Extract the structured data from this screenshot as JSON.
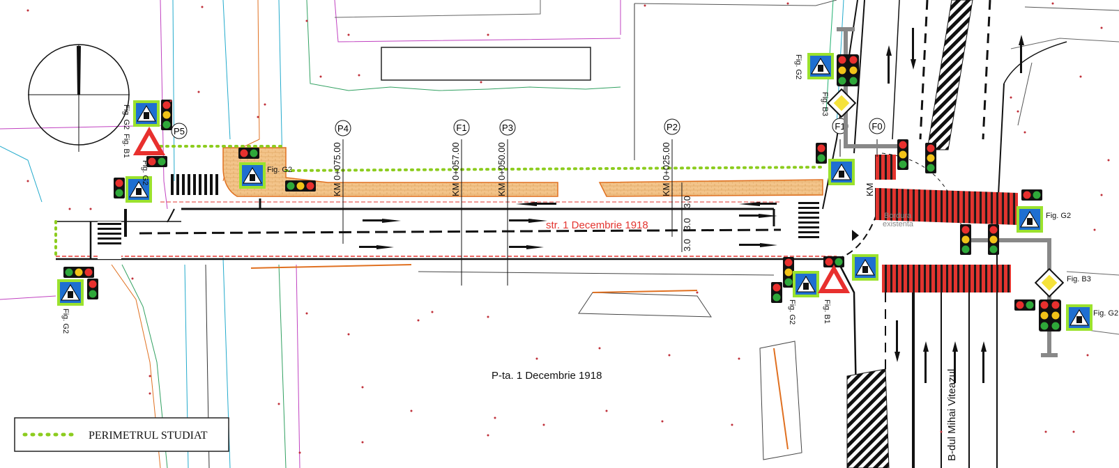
{
  "streets": {
    "main": "str. 1 Decembrie 1918",
    "square": "P-ta. 1 Decembrie 1918",
    "boulevard": "B-dul Mihai Viteazul"
  },
  "existing_note": [
    "Bordura",
    "existenta"
  ],
  "legend": {
    "label": "PERIMETRUL STUDIAT"
  },
  "profiles": [
    "P5",
    "P4",
    "F1",
    "P3",
    "P2",
    "F1",
    "F0"
  ],
  "chainages": [
    "KM 0+075.00",
    "KM 0+057.00",
    "KM 0+050.00",
    "KM 0+025.00",
    "KM"
  ],
  "lane_widths": [
    "3.0",
    "3.0",
    "3.0"
  ],
  "sign_labels": {
    "fig_g2": "Fig. G2",
    "fig_b1": "Fig. B1",
    "fig_b3": "Fig. B3"
  },
  "colors": {
    "perimeter": "#8ccc1e",
    "crossing": "#e8302e",
    "sidewalk": "#f3c48a",
    "sign_blue": "#1f6fd1",
    "sign_green": "#9be22d",
    "road_red": "#e3342f"
  }
}
